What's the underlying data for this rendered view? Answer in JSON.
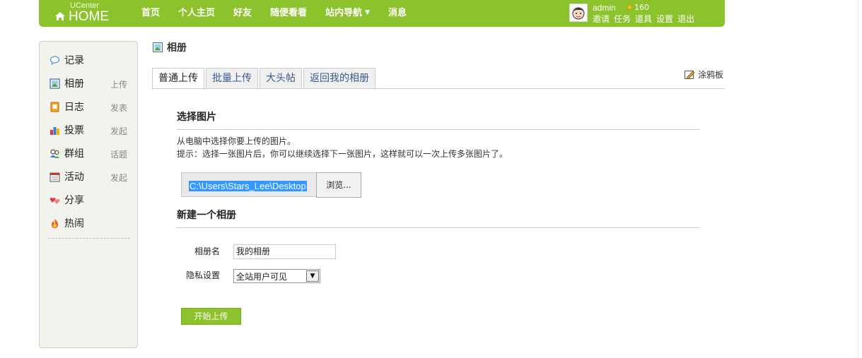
{
  "header": {
    "logo_small": "UCenter",
    "logo_main": "HOME",
    "nav": [
      {
        "label": "首页"
      },
      {
        "label": "个人主页"
      },
      {
        "label": "好友"
      },
      {
        "label": "随便看看"
      },
      {
        "label": "站内导航",
        "has_dropdown": true
      },
      {
        "label": "消息"
      }
    ],
    "user": {
      "name": "admin",
      "credits": "160",
      "links": [
        "邀请",
        "任务",
        "道具",
        "设置",
        "退出"
      ]
    },
    "accent_color": "#8cc22b"
  },
  "sidebar": {
    "items": [
      {
        "label": "记录",
        "action": "",
        "icon": "speech-bubble-icon"
      },
      {
        "label": "相册",
        "action": "上传",
        "icon": "photo-icon"
      },
      {
        "label": "日志",
        "action": "发表",
        "icon": "diary-icon"
      },
      {
        "label": "投票",
        "action": "发起",
        "icon": "bar-chart-icon"
      },
      {
        "label": "群组",
        "action": "话题",
        "icon": "group-icon"
      },
      {
        "label": "活动",
        "action": "发起",
        "icon": "calendar-icon"
      },
      {
        "label": "分享",
        "action": "",
        "icon": "hearts-icon"
      },
      {
        "label": "热闹",
        "action": "",
        "icon": "fire-icon"
      }
    ]
  },
  "main": {
    "title": "相册",
    "tabs": [
      {
        "label": "普通上传",
        "active": true
      },
      {
        "label": "批量上传",
        "active": false
      },
      {
        "label": "大头帖",
        "active": false
      },
      {
        "label": "返回我的相册",
        "active": false
      }
    ],
    "graffiti_link": "涂鸦板",
    "select_section": {
      "title": "选择图片",
      "desc1": "从电脑中选择你要上传的图片。",
      "desc2": "提示：选择一张图片后，你可以继续选择下一张图片，这样就可以一次上传多张图片了。",
      "file_path": "C:\\Users\\Stars_Lee\\Desktop",
      "browse_label": "浏览..."
    },
    "new_album_section": {
      "title": "新建一个相册",
      "name_label": "相册名",
      "name_value": "我的相册",
      "privacy_label": "隐私设置",
      "privacy_value": "全站用户可见"
    },
    "submit_label": "开始上传"
  }
}
